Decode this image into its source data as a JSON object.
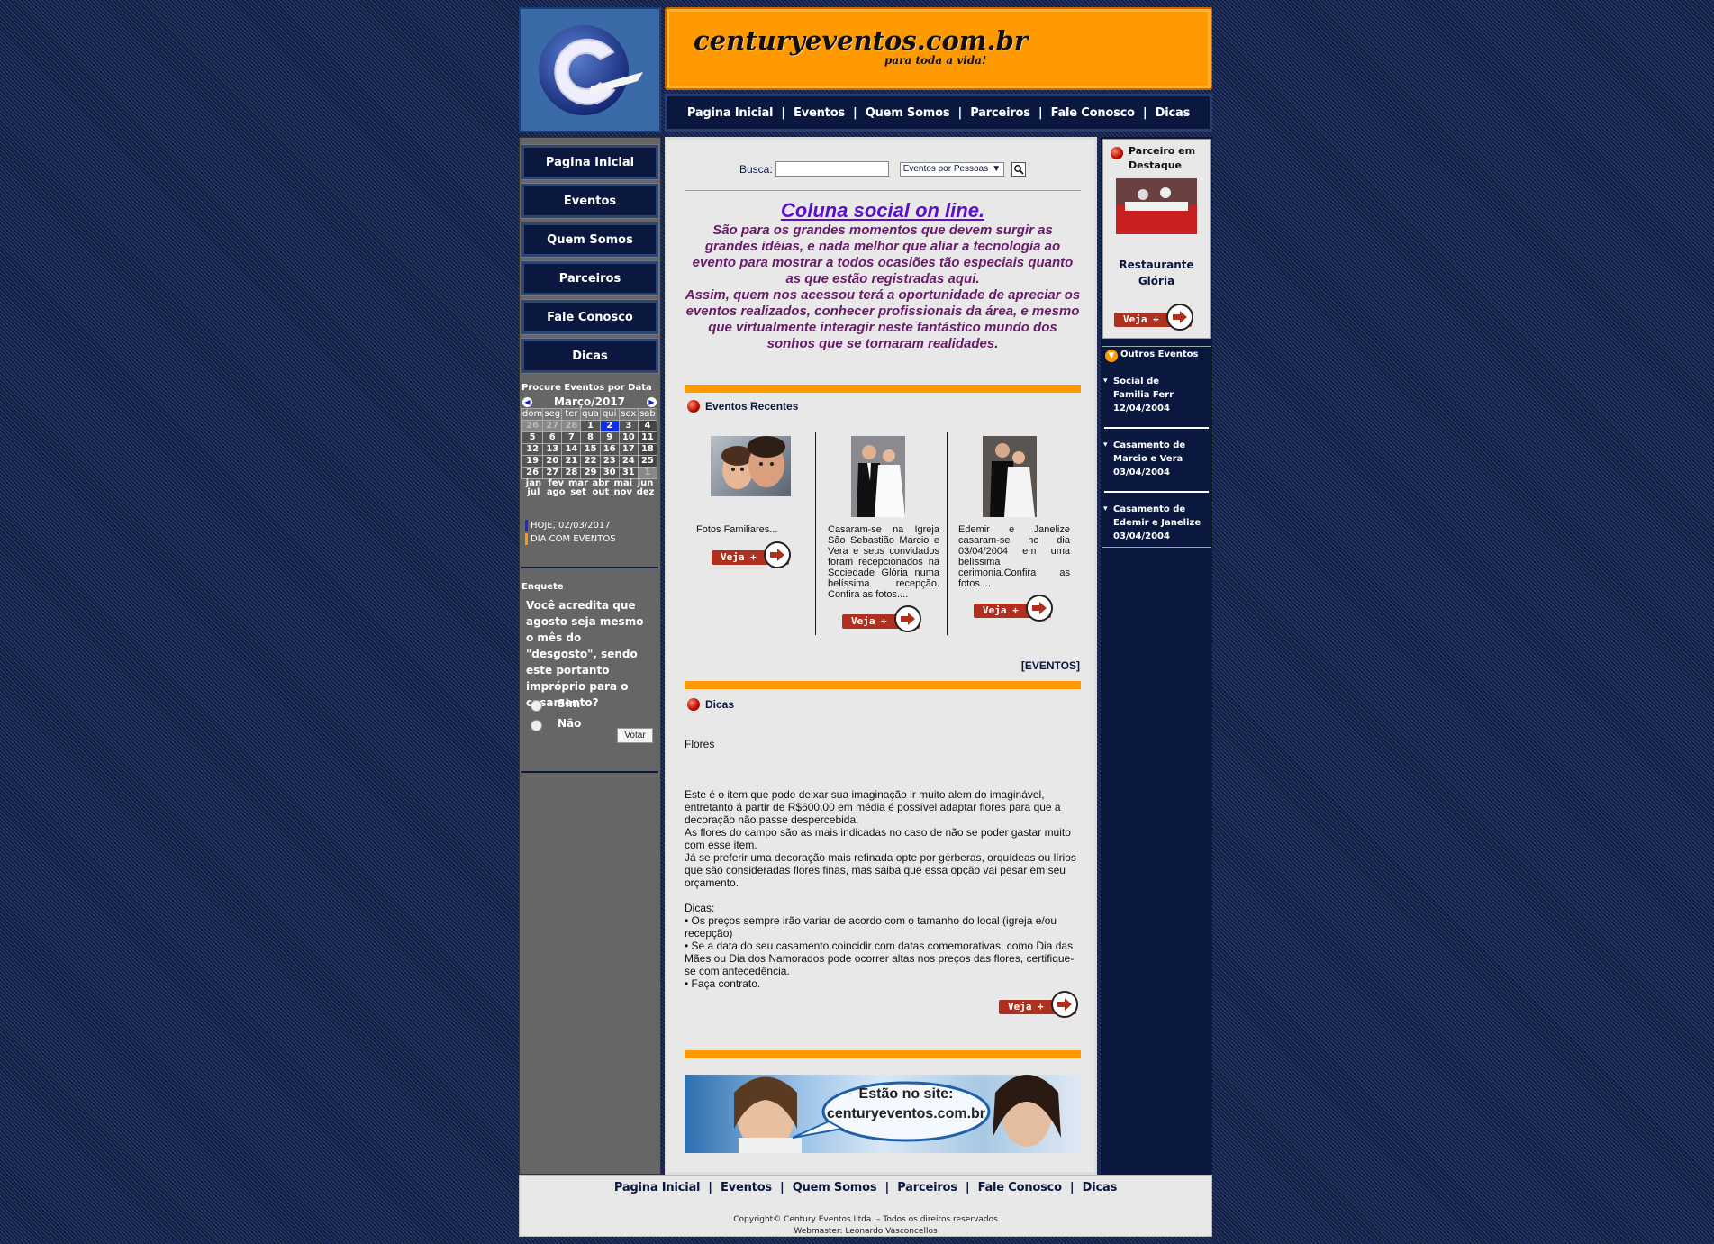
{
  "site": {
    "domain": "centuryeventos.com.br",
    "tagline": "para toda a vida!"
  },
  "nav": [
    "Pagina Inicial",
    "Eventos",
    "Quem Somos",
    "Parceiros",
    "Fale Conosco",
    "Dicas"
  ],
  "calendar": {
    "title": "Procure Eventos por Data",
    "month": "Março/2017",
    "weekdays": [
      "dom",
      "seg",
      "ter",
      "qua",
      "qui",
      "sex",
      "sab"
    ],
    "days": [
      "26",
      "27",
      "28",
      "1",
      "2",
      "3",
      "4",
      "5",
      "6",
      "7",
      "8",
      "9",
      "10",
      "11",
      "12",
      "13",
      "14",
      "15",
      "16",
      "17",
      "18",
      "19",
      "20",
      "21",
      "22",
      "23",
      "24",
      "25",
      "26",
      "27",
      "28",
      "29",
      "30",
      "31",
      "1"
    ],
    "months_row1": [
      "jan",
      "fev",
      "mar",
      "abr",
      "mai",
      "jun"
    ],
    "months_row2": [
      "jul",
      "ago",
      "set",
      "out",
      "nov",
      "dez"
    ],
    "legend_today": "HOJE, 02/03/2017",
    "legend_events": "DIA COM EVENTOS"
  },
  "poll": {
    "title": "Enquete",
    "question": "Você acredita que agosto seja mesmo o mês do \"desgosto\", sendo este portanto impróprio para o casamento?",
    "option_yes": "Sim",
    "option_no": "Não",
    "vote_label": "Votar"
  },
  "search": {
    "label": "Busca:",
    "value": "",
    "select_value": "Eventos por Pessoas"
  },
  "intro": {
    "title": "Coluna social on line.",
    "paragraph1": "São para os grandes momentos que devem surgir as grandes idéias, e nada melhor que aliar a tecnologia ao evento para mostrar a todos ocasiões tão especiais quanto as que estão registradas aqui.",
    "paragraph2": "Assim, quem nos acessou terá a oportunidade de apreciar os eventos realizados, conhecer profissionais da área, e mesmo que virtualmente interagir neste fantástico mundo dos sonhos que se tornaram realidades."
  },
  "recent": {
    "heading": "Eventos Recentes",
    "items": [
      {
        "text": "Fotos Familiares..."
      },
      {
        "text": "Casaram-se na Igreja São Sebastião Marcio e Vera e seus convidados foram recepcionados na Sociedade Glória numa belíssima recepção. Confira as fotos...."
      },
      {
        "text": "Edemir e Janelize casaram-se no dia 03/04/2004 em uma belíssima cerimonia.Confira as fotos...."
      }
    ],
    "more_link": "[EVENTOS]"
  },
  "veja_label": "Veja +",
  "dicas": {
    "heading": "Dicas",
    "subtitle": "Flores",
    "p1": "Este é o item que pode deixar sua imaginação ir muito alem do imaginável, entretanto á partir de R$600,00 em média é possível adaptar flores para que a decoração não passe despercebida.",
    "p2": "As flores do campo são as mais indicadas no caso de não se poder gastar muito com esse item.",
    "p3": "Já se preferir uma decoração mais refinada opte por gérberas, orquídeas ou lírios que são consideradas flores finas, mas saiba que essa opção vai pesar em seu orçamento.",
    "p4": "Dicas:",
    "b1": "• Os preços sempre irão variar de acordo com o tamanho do local (igreja e/ou recepção)",
    "b2": "• Se a data do seu casamento coincidir com datas comemorativas, como Dia das Mães ou Dia dos Namorados pode ocorrer altas nos preços das flores, certifique-se com antecedência.",
    "b3": "• Faça contrato."
  },
  "promo": {
    "line1": "Estão no site:",
    "line2": "centuryeventos.com.br"
  },
  "partner": {
    "heading": "Parceiro em Destaque",
    "name": "Restaurante Glória"
  },
  "others": {
    "heading": "Outros Eventos",
    "items": [
      {
        "line1": "Social de",
        "line2": "Familia Ferr",
        "date": "12/04/2004"
      },
      {
        "line1": "Casamento de",
        "line2": "Marcio e Vera",
        "date": "03/04/2004"
      },
      {
        "line1": "Casamento de",
        "line2": "Edemir e Janelize",
        "date": "03/04/2004"
      }
    ]
  },
  "footer": {
    "copyright": "Copyright© Century Eventos Ltda. – Todos os direitos reservados",
    "webmaster": "Webmaster: Leonardo Vasconcellos"
  },
  "colors": {
    "navy": "#0a1840",
    "orange": "#ff9900",
    "title_purple": "#5a10c8",
    "text_purple": "#6a1a6a",
    "veja_red": "#b03020"
  }
}
